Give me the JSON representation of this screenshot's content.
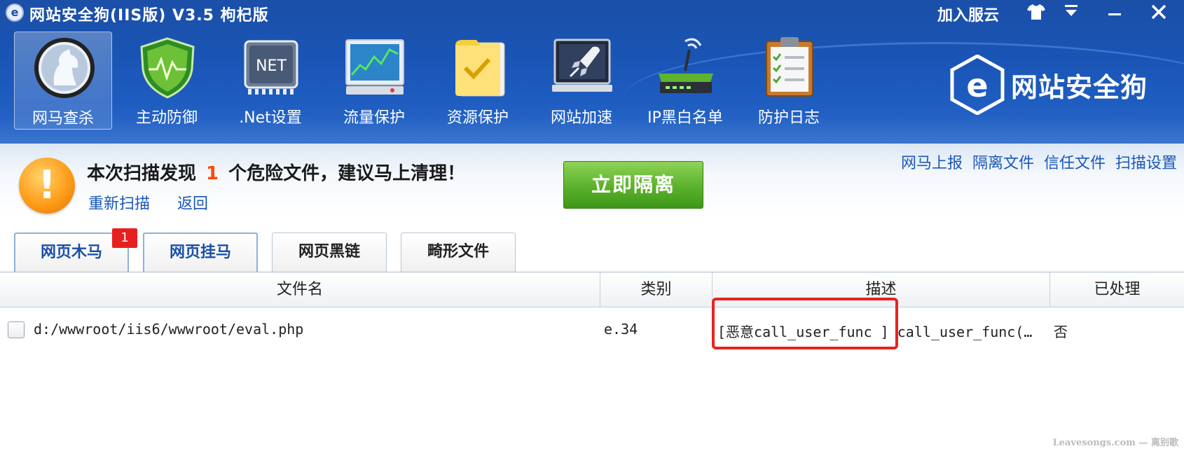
{
  "titlebar": {
    "title": "网站安全狗(IIS版) V3.5 枸杞版",
    "join_cloud": "加入服云"
  },
  "toolbar": {
    "items": [
      {
        "label": "网马查杀",
        "icon": "horse-scan-icon",
        "active": true
      },
      {
        "label": "主动防御",
        "icon": "shield-icon"
      },
      {
        "label": ".Net设置",
        "icon": "net-chip-icon"
      },
      {
        "label": "流量保护",
        "icon": "traffic-monitor-icon"
      },
      {
        "label": "资源保护",
        "icon": "folder-check-icon"
      },
      {
        "label": "网站加速",
        "icon": "rocket-icon"
      },
      {
        "label": "IP黑白名单",
        "icon": "router-icon"
      },
      {
        "label": "防护日志",
        "icon": "clipboard-icon"
      }
    ]
  },
  "brand": {
    "logo_letter": "e",
    "text": "网站安全狗"
  },
  "alert": {
    "prefix": "本次扫描发现",
    "count": "1",
    "suffix": "个危险文件，建议马上清理！",
    "rescan": "重新扫描",
    "back": "返回",
    "isolate_button": "立即隔离",
    "icon": "warning-icon"
  },
  "top_links": [
    "网马上报",
    "隔离文件",
    "信任文件",
    "扫描设置"
  ],
  "tabs": [
    {
      "label": "网页木马",
      "badge": "1"
    },
    {
      "label": "网页挂马"
    },
    {
      "label": "网页黑链"
    },
    {
      "label": "畸形文件"
    }
  ],
  "table": {
    "headers": [
      "文件名",
      "类别",
      "描述",
      "已处理"
    ],
    "rows": [
      {
        "file": "d:/wwwroot/iis6/wwwroot/eval.php",
        "category": "e.34",
        "description": "[恶意call_user_func ] call_user_func(…",
        "handled": "否"
      }
    ]
  },
  "colors": {
    "header_blue": "#1a55b5",
    "link_blue": "#1a58b8",
    "alert_count": "#ff4a00",
    "isolate_green": "#5fb42f",
    "highlight_red": "#e8231f"
  },
  "watermark": "Leavesongs.com — 离别歌"
}
